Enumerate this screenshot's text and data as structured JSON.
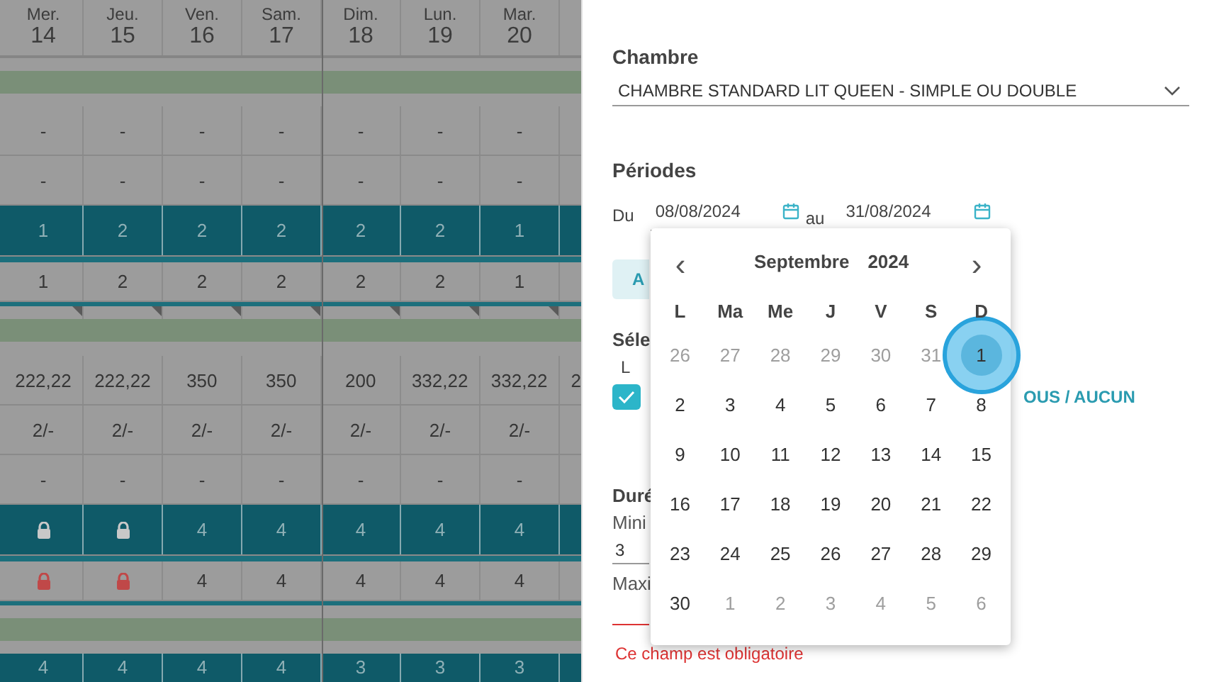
{
  "grid": {
    "rows": [
      {
        "kind": "header",
        "cells": [
          {
            "day": "Mer.",
            "date": "14"
          },
          {
            "day": "Jeu.",
            "date": "15"
          },
          {
            "day": "Ven.",
            "date": "16"
          },
          {
            "day": "Sam.",
            "date": "17"
          },
          {
            "day": "Dim.",
            "date": "18"
          },
          {
            "day": "Lun.",
            "date": "19"
          },
          {
            "day": "Mar.",
            "date": "20"
          }
        ]
      },
      {
        "kind": "band"
      },
      {
        "kind": "plain",
        "cells": [
          "-",
          "-",
          "-",
          "-",
          "-",
          "-",
          "-"
        ]
      },
      {
        "kind": "plain",
        "cells": [
          "-",
          "-",
          "-",
          "-",
          "-",
          "-",
          "-"
        ]
      },
      {
        "kind": "teal",
        "cells": [
          "1",
          "2",
          "2",
          "2",
          "2",
          "2",
          "1"
        ]
      },
      {
        "kind": "plain_bar",
        "cells": [
          "1",
          "2",
          "2",
          "2",
          "2",
          "2",
          "1"
        ]
      },
      {
        "kind": "band_flag"
      },
      {
        "kind": "plain",
        "cells": [
          "222,22",
          "222,22",
          "350",
          "350",
          "200",
          "332,22",
          "332,22"
        ],
        "overflow": "2"
      },
      {
        "kind": "plain",
        "cells": [
          "2/-",
          "2/-",
          "2/-",
          "2/-",
          "2/-",
          "2/-",
          "2/-"
        ]
      },
      {
        "kind": "plain",
        "cells": [
          "-",
          "-",
          "-",
          "-",
          "-",
          "-",
          "-"
        ]
      },
      {
        "kind": "teal",
        "cells": [
          {
            "kind": "lock"
          },
          {
            "kind": "lock"
          },
          "4",
          "4",
          "4",
          "4",
          "4"
        ]
      },
      {
        "kind": "plain_bar",
        "cells": [
          {
            "kind": "lock"
          },
          {
            "kind": "lock"
          },
          "4",
          "4",
          "4",
          "4",
          "4"
        ]
      },
      {
        "kind": "band"
      },
      {
        "kind": "teal",
        "cells": [
          "4",
          "4",
          "4",
          "4",
          "3",
          "3",
          "3"
        ]
      }
    ]
  },
  "panel": {
    "room_label": "Chambre",
    "room_value": "CHAMBRE STANDARD LIT QUEEN - SIMPLE OU DOUBLE",
    "periods_label": "Périodes",
    "from_label": "Du",
    "from_value": "08/08/2024",
    "to_label": "au",
    "to_value": "31/08/2024",
    "add_button": "A",
    "selection_label": "Séle",
    "day_label": "L",
    "day_checked": true,
    "all_none_link": "OUS / AUCUN",
    "duration_label": "Duré",
    "min_label": "Mini",
    "min_value": "3",
    "max_label": "Maxi",
    "max_error": true,
    "error_text": "Ce champ est obligatoire"
  },
  "calendar": {
    "month": "Septembre",
    "year": "2024",
    "prev": "‹",
    "next": "›",
    "weekdays": [
      "L",
      "Ma",
      "Me",
      "J",
      "V",
      "S",
      "D"
    ],
    "weeks": [
      [
        {
          "label": "26",
          "muted": true
        },
        {
          "label": "27",
          "muted": true
        },
        {
          "label": "28",
          "muted": true
        },
        {
          "label": "29",
          "muted": true
        },
        {
          "label": "30",
          "muted": true
        },
        {
          "label": "31",
          "muted": true
        },
        {
          "label": "1",
          "muted": false,
          "focused": true
        }
      ],
      [
        {
          "label": "2",
          "muted": false
        },
        {
          "label": "3",
          "muted": false
        },
        {
          "label": "4",
          "muted": false
        },
        {
          "label": "5",
          "muted": false
        },
        {
          "label": "6",
          "muted": false
        },
        {
          "label": "7",
          "muted": false
        },
        {
          "label": "8",
          "muted": false
        }
      ],
      [
        {
          "label": "9",
          "muted": false
        },
        {
          "label": "10",
          "muted": false
        },
        {
          "label": "11",
          "muted": false
        },
        {
          "label": "12",
          "muted": false
        },
        {
          "label": "13",
          "muted": false
        },
        {
          "label": "14",
          "muted": false
        },
        {
          "label": "15",
          "muted": false
        }
      ],
      [
        {
          "label": "16",
          "muted": false
        },
        {
          "label": "17",
          "muted": false
        },
        {
          "label": "18",
          "muted": false
        },
        {
          "label": "19",
          "muted": false
        },
        {
          "label": "20",
          "muted": false
        },
        {
          "label": "21",
          "muted": false
        },
        {
          "label": "22",
          "muted": false
        }
      ],
      [
        {
          "label": "23",
          "muted": false
        },
        {
          "label": "24",
          "muted": false
        },
        {
          "label": "25",
          "muted": false
        },
        {
          "label": "26",
          "muted": false
        },
        {
          "label": "27",
          "muted": false
        },
        {
          "label": "28",
          "muted": false
        },
        {
          "label": "29",
          "muted": false
        }
      ],
      [
        {
          "label": "30",
          "muted": false
        },
        {
          "label": "1",
          "muted": true
        },
        {
          "label": "2",
          "muted": true
        },
        {
          "label": "3",
          "muted": true
        },
        {
          "label": "4",
          "muted": true
        },
        {
          "label": "5",
          "muted": true
        },
        {
          "label": "6",
          "muted": true
        }
      ]
    ]
  }
}
